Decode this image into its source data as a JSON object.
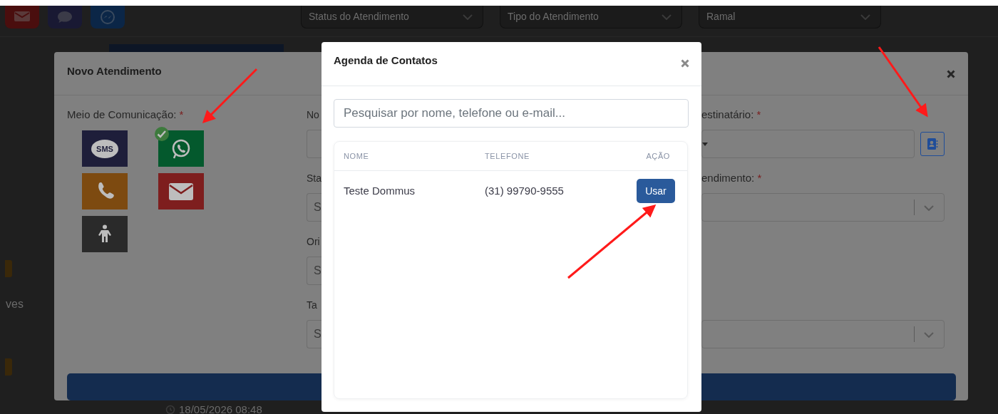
{
  "background": {
    "channel_icons": [
      {
        "kind": "mail"
      },
      {
        "kind": "chat"
      },
      {
        "kind": "messenger"
      }
    ],
    "filters": [
      {
        "placeholder": "Status do Atendimento"
      },
      {
        "placeholder": "Tipo do Atendimento"
      },
      {
        "placeholder": "Ramal"
      }
    ],
    "side_text": "ves",
    "timestamp": "18/05/2026 08:48"
  },
  "new_ticket_modal": {
    "title": "Novo Atendimento",
    "channel_field": {
      "label": "Meio de Comunicação:",
      "required_mark": "*"
    },
    "channels": [
      {
        "kind": "sms",
        "text": "SMS",
        "selected": false
      },
      {
        "kind": "whatsapp",
        "selected": true
      },
      {
        "kind": "phone",
        "selected": false
      },
      {
        "kind": "email",
        "selected": false
      },
      {
        "kind": "in_person",
        "selected": false
      }
    ],
    "form_rows": [
      {
        "left": {
          "label": "No"
        },
        "right": {
          "kind": "phone",
          "label": "estinatário:",
          "required_mark": "*"
        }
      },
      {
        "left": {
          "label": "Sta",
          "placeholder": "S"
        },
        "right": {
          "kind": "select",
          "label": "endimento:",
          "required_mark": "*"
        }
      },
      {
        "left": {
          "label": "Ori",
          "placeholder": "S"
        }
      },
      {
        "left": {
          "label": "Ta",
          "placeholder": "S"
        },
        "right": {
          "kind": "select"
        }
      }
    ]
  },
  "contacts_modal": {
    "title": "Agenda de Contatos",
    "search": {
      "placeholder": "Pesquisar por nome, telefone ou e-mail..."
    },
    "table": {
      "columns": [
        "NOME",
        "TELEFONE",
        "AÇÃO"
      ],
      "rows": [
        {
          "name": "Teste Dommus",
          "phone": "(31) 99790-9555",
          "action": "Usar"
        }
      ]
    }
  },
  "annotations": [
    {
      "kind": "arrow"
    },
    {
      "kind": "arrow"
    },
    {
      "kind": "arrow"
    }
  ]
}
